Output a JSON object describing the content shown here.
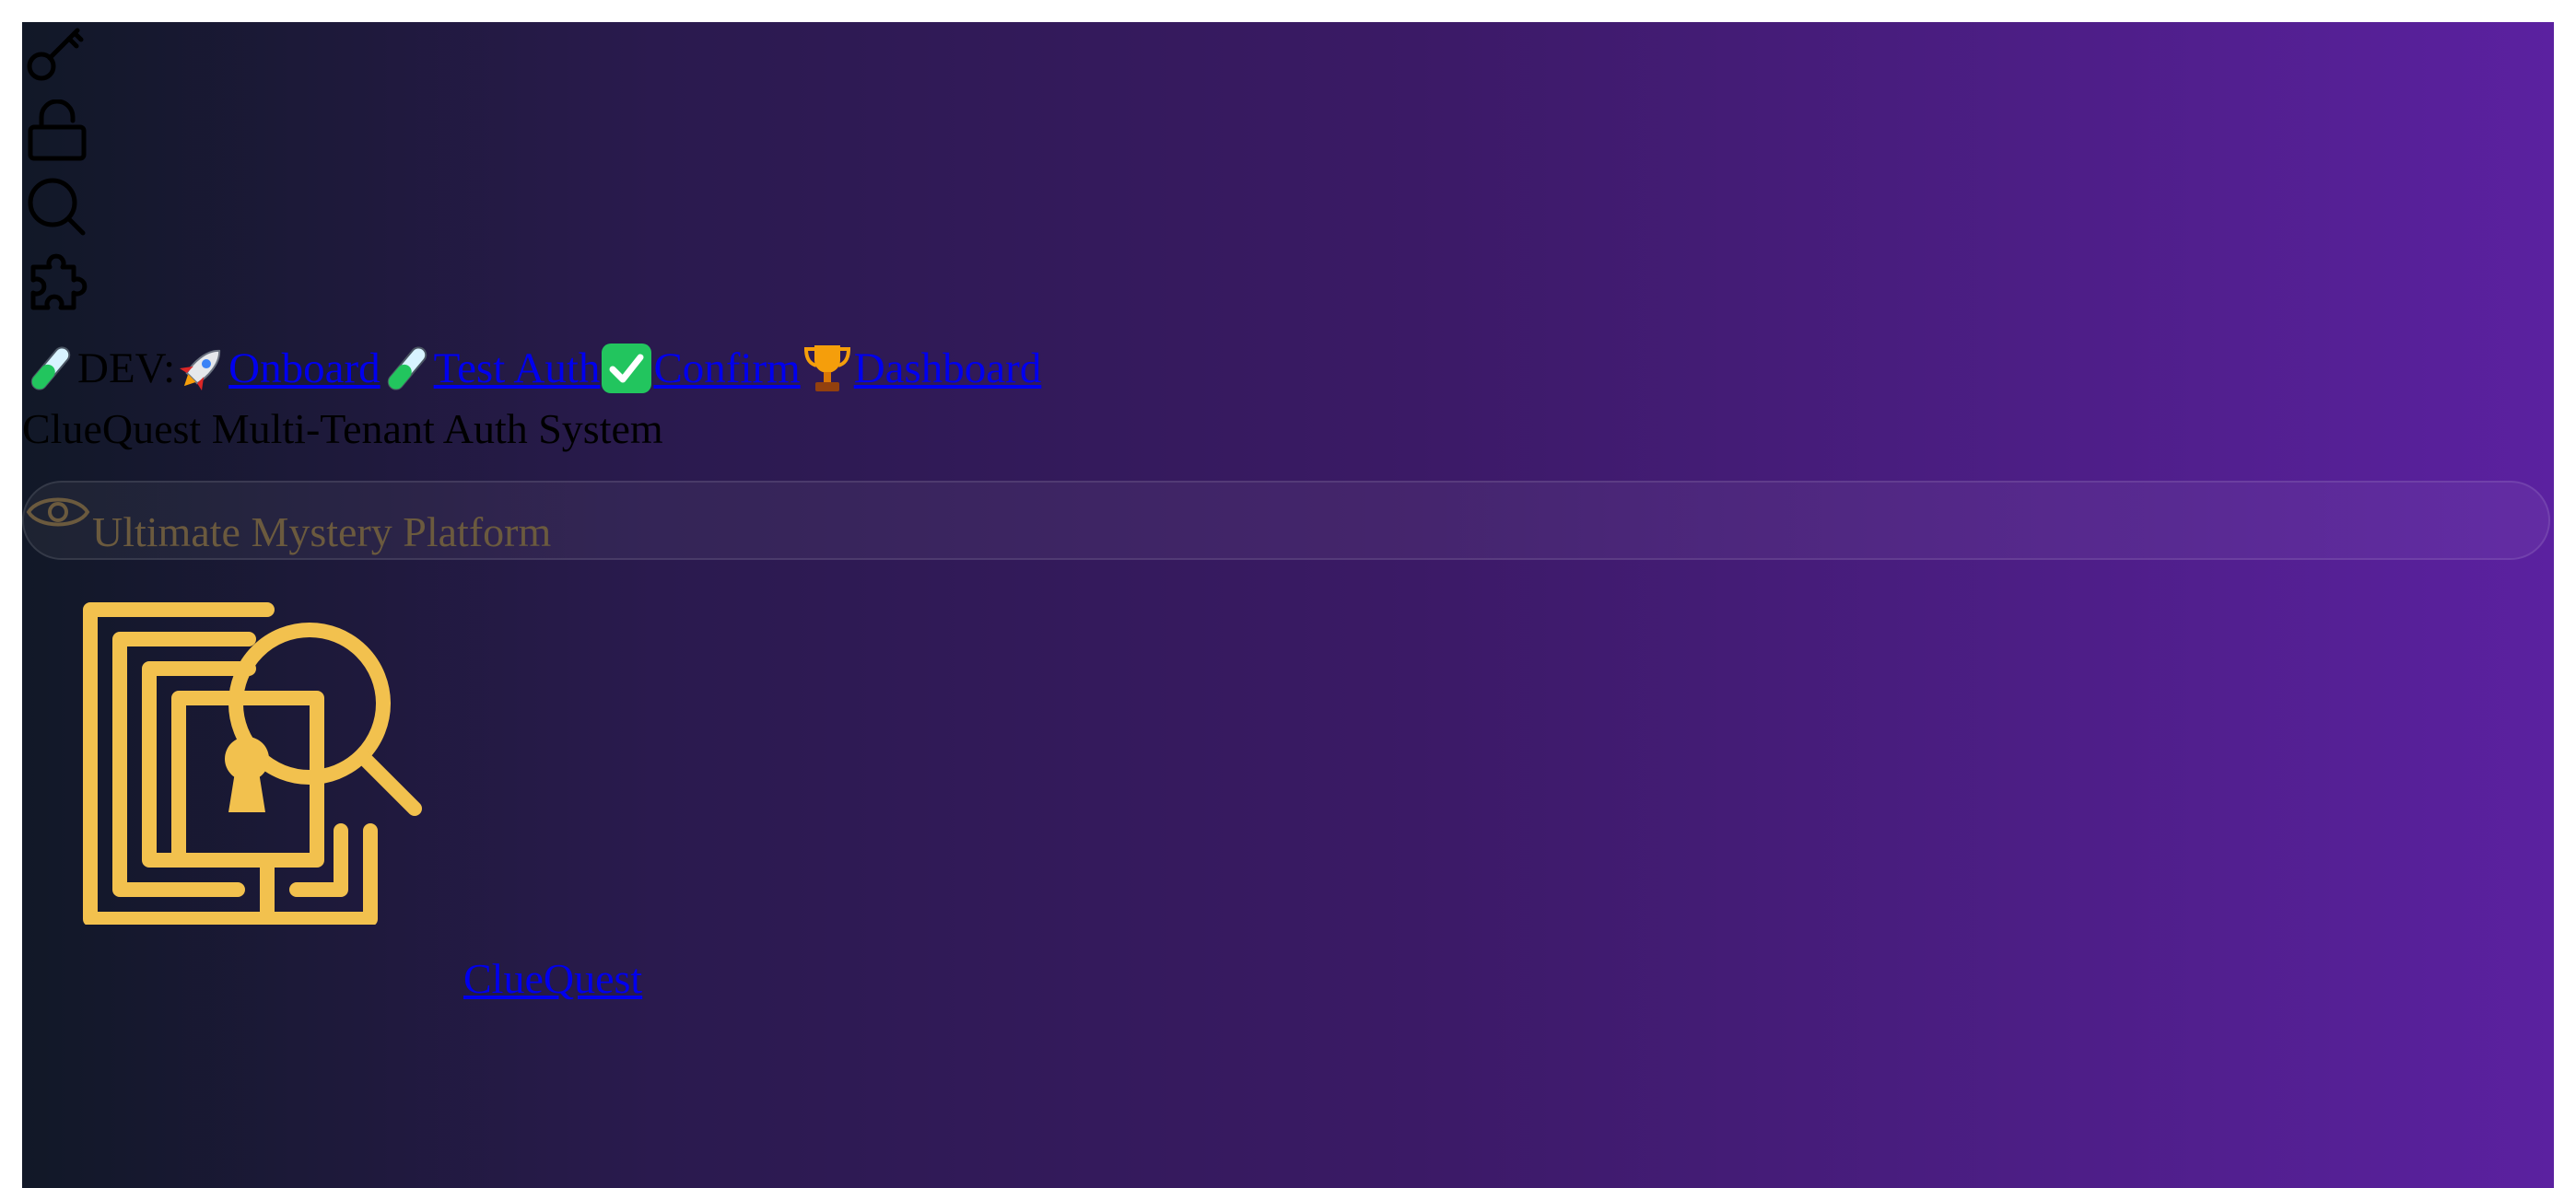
{
  "dev_bar": {
    "label": "DEV:",
    "links": [
      {
        "label": " Onboard",
        "icon": "rocket-icon"
      },
      {
        "label": " Test Auth",
        "icon": "test-tube-icon"
      },
      {
        "label": " Confirm",
        "icon": "check-mark-icon"
      },
      {
        "label": " Dashboard",
        "icon": "trophy-icon"
      }
    ]
  },
  "decorative_icons": [
    "key-icon",
    "lock-icon",
    "magnifier-icon",
    "puzzle-icon"
  ],
  "tagline": "ClueQuest Multi-Tenant Auth System",
  "search": {
    "placeholder": "Ultimate Mystery Platform",
    "icon": "eye-icon"
  },
  "brand": {
    "logo_icon": "maze-keyhole-magnifier-logo",
    "name": "ClueQuest"
  },
  "colors": {
    "gradient_start": "#111827",
    "gradient_end": "#5b21a0",
    "accent_gold": "#f2c14e",
    "link": "#0000ee"
  }
}
